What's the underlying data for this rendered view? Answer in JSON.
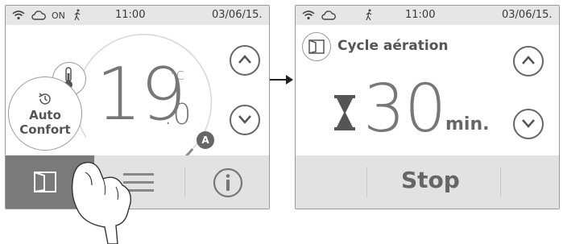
{
  "screen1": {
    "status": {
      "wifi_icon": "wifi-icon",
      "cloud_icon": "cloud-icon",
      "on_label": "ON",
      "presence_icon": "walking-person-icon",
      "time": "11:00",
      "date": "03/06/15."
    },
    "temperature": {
      "integer": "19",
      "decimal": ".0",
      "unit": "°C"
    },
    "mode": {
      "line1": "Auto",
      "line2": "Confort"
    },
    "auto_badge": "A",
    "buttons": {
      "up_icon": "chevron-up-icon",
      "down_icon": "chevron-down-icon",
      "window_icon": "window-icon",
      "menu_icon": "menu-icon",
      "info_icon": "info-icon"
    }
  },
  "screen2": {
    "status": {
      "time": "11:00",
      "date": "03/06/15."
    },
    "title": "Cycle aération",
    "duration": {
      "value": "30",
      "unit": "min."
    },
    "stop_label": "Stop"
  },
  "colors": {
    "frame": "#9a9a9a",
    "status_bg": "#e6e6e6",
    "bar_bg": "#e2e2e2",
    "active_tab": "#7a7a7a",
    "digits": "#777777"
  }
}
